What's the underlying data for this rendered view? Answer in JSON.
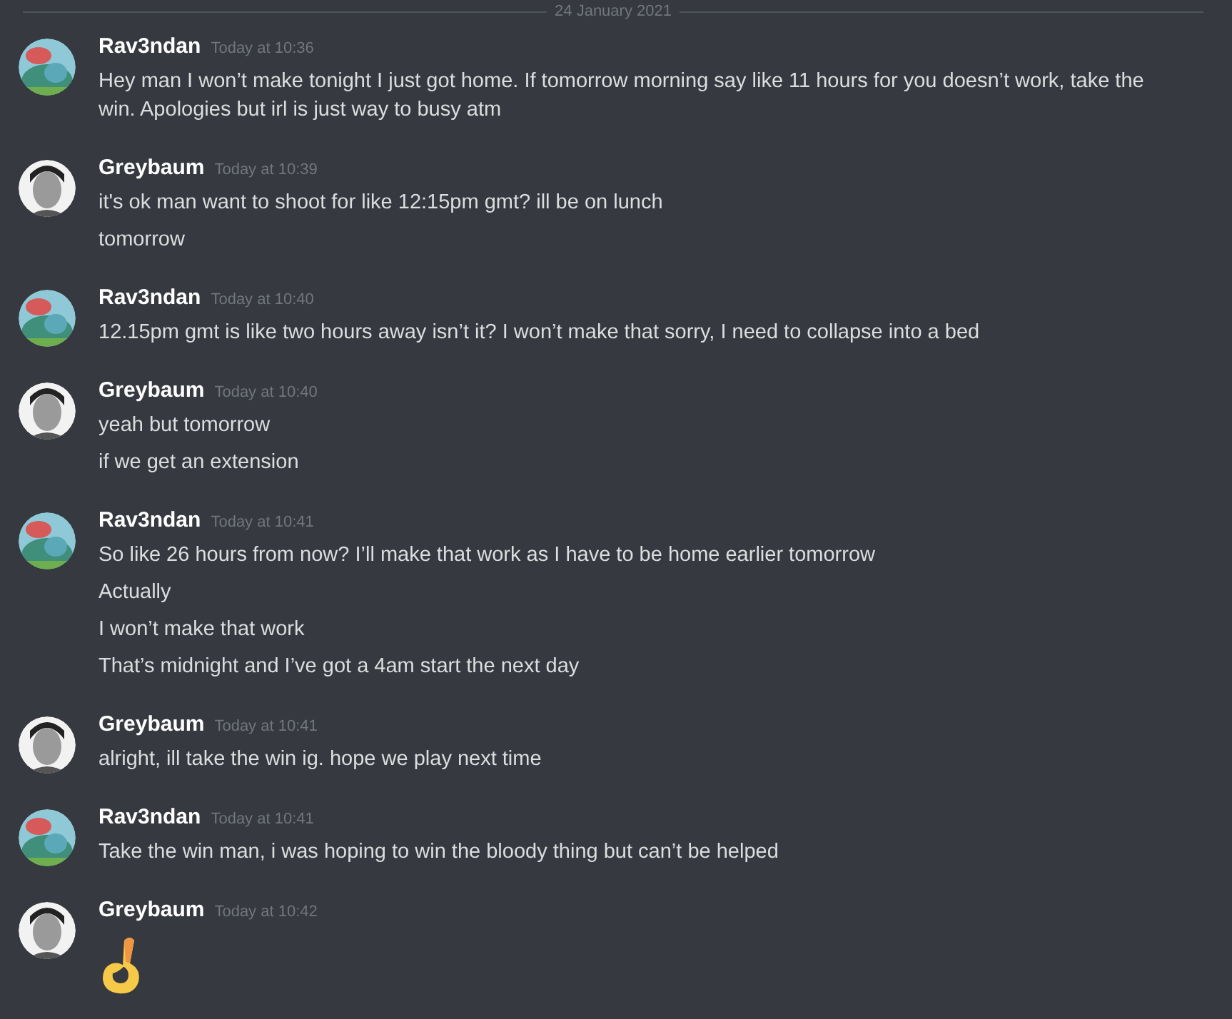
{
  "divider": {
    "date": "24 January 2021"
  },
  "groups": [
    {
      "author": "Rav3ndan",
      "avatar": {
        "kind": "creature"
      },
      "time": "Today at 10:36",
      "messages": [
        {
          "kind": "text",
          "text": "Hey man I won’t make tonight I just got home. If tomorrow morning say like 11 hours for you doesn’t work, take the win. Apologies but irl is just way to busy atm"
        }
      ]
    },
    {
      "author": "Greybaum",
      "avatar": {
        "kind": "figure"
      },
      "time": "Today at 10:39",
      "messages": [
        {
          "kind": "text",
          "text": "it's ok man want to shoot for like 12:15pm gmt? ill be on lunch"
        },
        {
          "kind": "text",
          "text": "tomorrow"
        }
      ]
    },
    {
      "author": "Rav3ndan",
      "avatar": {
        "kind": "creature"
      },
      "time": "Today at 10:40",
      "messages": [
        {
          "kind": "text",
          "text": "12.15pm gmt is like two hours away isn’t it? I won’t make that sorry, I need to collapse into a bed"
        }
      ]
    },
    {
      "author": "Greybaum",
      "avatar": {
        "kind": "figure"
      },
      "time": "Today at 10:40",
      "messages": [
        {
          "kind": "text",
          "text": "yeah but tomorrow"
        },
        {
          "kind": "text",
          "text": "if we get an extension"
        }
      ]
    },
    {
      "author": "Rav3ndan",
      "avatar": {
        "kind": "creature"
      },
      "time": "Today at 10:41",
      "messages": [
        {
          "kind": "text",
          "text": "So like 26 hours from now? I’ll make that work as I have to be home earlier tomorrow"
        },
        {
          "kind": "text",
          "text": "Actually"
        },
        {
          "kind": "text",
          "text": "I won’t make that work"
        },
        {
          "kind": "text",
          "text": "That’s midnight and I’ve got a 4am start the next day"
        }
      ]
    },
    {
      "author": "Greybaum",
      "avatar": {
        "kind": "figure"
      },
      "time": "Today at 10:41",
      "messages": [
        {
          "kind": "text",
          "text": "alright, ill take the win ig. hope we play next time"
        }
      ]
    },
    {
      "author": "Rav3ndan",
      "avatar": {
        "kind": "creature"
      },
      "time": "Today at 10:41",
      "messages": [
        {
          "kind": "text",
          "text": "Take the win man, i was hoping to win the bloody thing but can’t be helped"
        }
      ]
    },
    {
      "author": "Greybaum",
      "avatar": {
        "kind": "figure"
      },
      "time": "Today at 10:42",
      "messages": [
        {
          "kind": "emoji"
        }
      ]
    }
  ]
}
